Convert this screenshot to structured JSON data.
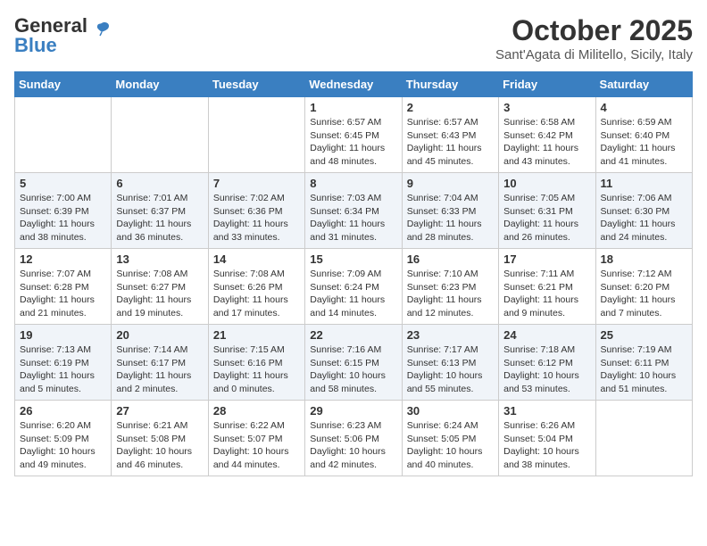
{
  "header": {
    "logo_general": "General",
    "logo_blue": "Blue",
    "month_title": "October 2025",
    "subtitle": "Sant'Agata di Militello, Sicily, Italy"
  },
  "days_of_week": [
    "Sunday",
    "Monday",
    "Tuesday",
    "Wednesday",
    "Thursday",
    "Friday",
    "Saturday"
  ],
  "weeks": [
    [
      {
        "day": "",
        "sunrise": "",
        "sunset": "",
        "daylight": ""
      },
      {
        "day": "",
        "sunrise": "",
        "sunset": "",
        "daylight": ""
      },
      {
        "day": "",
        "sunrise": "",
        "sunset": "",
        "daylight": ""
      },
      {
        "day": "1",
        "sunrise": "Sunrise: 6:57 AM",
        "sunset": "Sunset: 6:45 PM",
        "daylight": "Daylight: 11 hours and 48 minutes."
      },
      {
        "day": "2",
        "sunrise": "Sunrise: 6:57 AM",
        "sunset": "Sunset: 6:43 PM",
        "daylight": "Daylight: 11 hours and 45 minutes."
      },
      {
        "day": "3",
        "sunrise": "Sunrise: 6:58 AM",
        "sunset": "Sunset: 6:42 PM",
        "daylight": "Daylight: 11 hours and 43 minutes."
      },
      {
        "day": "4",
        "sunrise": "Sunrise: 6:59 AM",
        "sunset": "Sunset: 6:40 PM",
        "daylight": "Daylight: 11 hours and 41 minutes."
      }
    ],
    [
      {
        "day": "5",
        "sunrise": "Sunrise: 7:00 AM",
        "sunset": "Sunset: 6:39 PM",
        "daylight": "Daylight: 11 hours and 38 minutes."
      },
      {
        "day": "6",
        "sunrise": "Sunrise: 7:01 AM",
        "sunset": "Sunset: 6:37 PM",
        "daylight": "Daylight: 11 hours and 36 minutes."
      },
      {
        "day": "7",
        "sunrise": "Sunrise: 7:02 AM",
        "sunset": "Sunset: 6:36 PM",
        "daylight": "Daylight: 11 hours and 33 minutes."
      },
      {
        "day": "8",
        "sunrise": "Sunrise: 7:03 AM",
        "sunset": "Sunset: 6:34 PM",
        "daylight": "Daylight: 11 hours and 31 minutes."
      },
      {
        "day": "9",
        "sunrise": "Sunrise: 7:04 AM",
        "sunset": "Sunset: 6:33 PM",
        "daylight": "Daylight: 11 hours and 28 minutes."
      },
      {
        "day": "10",
        "sunrise": "Sunrise: 7:05 AM",
        "sunset": "Sunset: 6:31 PM",
        "daylight": "Daylight: 11 hours and 26 minutes."
      },
      {
        "day": "11",
        "sunrise": "Sunrise: 7:06 AM",
        "sunset": "Sunset: 6:30 PM",
        "daylight": "Daylight: 11 hours and 24 minutes."
      }
    ],
    [
      {
        "day": "12",
        "sunrise": "Sunrise: 7:07 AM",
        "sunset": "Sunset: 6:28 PM",
        "daylight": "Daylight: 11 hours and 21 minutes."
      },
      {
        "day": "13",
        "sunrise": "Sunrise: 7:08 AM",
        "sunset": "Sunset: 6:27 PM",
        "daylight": "Daylight: 11 hours and 19 minutes."
      },
      {
        "day": "14",
        "sunrise": "Sunrise: 7:08 AM",
        "sunset": "Sunset: 6:26 PM",
        "daylight": "Daylight: 11 hours and 17 minutes."
      },
      {
        "day": "15",
        "sunrise": "Sunrise: 7:09 AM",
        "sunset": "Sunset: 6:24 PM",
        "daylight": "Daylight: 11 hours and 14 minutes."
      },
      {
        "day": "16",
        "sunrise": "Sunrise: 7:10 AM",
        "sunset": "Sunset: 6:23 PM",
        "daylight": "Daylight: 11 hours and 12 minutes."
      },
      {
        "day": "17",
        "sunrise": "Sunrise: 7:11 AM",
        "sunset": "Sunset: 6:21 PM",
        "daylight": "Daylight: 11 hours and 9 minutes."
      },
      {
        "day": "18",
        "sunrise": "Sunrise: 7:12 AM",
        "sunset": "Sunset: 6:20 PM",
        "daylight": "Daylight: 11 hours and 7 minutes."
      }
    ],
    [
      {
        "day": "19",
        "sunrise": "Sunrise: 7:13 AM",
        "sunset": "Sunset: 6:19 PM",
        "daylight": "Daylight: 11 hours and 5 minutes."
      },
      {
        "day": "20",
        "sunrise": "Sunrise: 7:14 AM",
        "sunset": "Sunset: 6:17 PM",
        "daylight": "Daylight: 11 hours and 2 minutes."
      },
      {
        "day": "21",
        "sunrise": "Sunrise: 7:15 AM",
        "sunset": "Sunset: 6:16 PM",
        "daylight": "Daylight: 11 hours and 0 minutes."
      },
      {
        "day": "22",
        "sunrise": "Sunrise: 7:16 AM",
        "sunset": "Sunset: 6:15 PM",
        "daylight": "Daylight: 10 hours and 58 minutes."
      },
      {
        "day": "23",
        "sunrise": "Sunrise: 7:17 AM",
        "sunset": "Sunset: 6:13 PM",
        "daylight": "Daylight: 10 hours and 55 minutes."
      },
      {
        "day": "24",
        "sunrise": "Sunrise: 7:18 AM",
        "sunset": "Sunset: 6:12 PM",
        "daylight": "Daylight: 10 hours and 53 minutes."
      },
      {
        "day": "25",
        "sunrise": "Sunrise: 7:19 AM",
        "sunset": "Sunset: 6:11 PM",
        "daylight": "Daylight: 10 hours and 51 minutes."
      }
    ],
    [
      {
        "day": "26",
        "sunrise": "Sunrise: 6:20 AM",
        "sunset": "Sunset: 5:09 PM",
        "daylight": "Daylight: 10 hours and 49 minutes."
      },
      {
        "day": "27",
        "sunrise": "Sunrise: 6:21 AM",
        "sunset": "Sunset: 5:08 PM",
        "daylight": "Daylight: 10 hours and 46 minutes."
      },
      {
        "day": "28",
        "sunrise": "Sunrise: 6:22 AM",
        "sunset": "Sunset: 5:07 PM",
        "daylight": "Daylight: 10 hours and 44 minutes."
      },
      {
        "day": "29",
        "sunrise": "Sunrise: 6:23 AM",
        "sunset": "Sunset: 5:06 PM",
        "daylight": "Daylight: 10 hours and 42 minutes."
      },
      {
        "day": "30",
        "sunrise": "Sunrise: 6:24 AM",
        "sunset": "Sunset: 5:05 PM",
        "daylight": "Daylight: 10 hours and 40 minutes."
      },
      {
        "day": "31",
        "sunrise": "Sunrise: 6:26 AM",
        "sunset": "Sunset: 5:04 PM",
        "daylight": "Daylight: 10 hours and 38 minutes."
      },
      {
        "day": "",
        "sunrise": "",
        "sunset": "",
        "daylight": ""
      }
    ]
  ],
  "row_styles": [
    "white",
    "shaded",
    "white",
    "shaded",
    "white"
  ]
}
